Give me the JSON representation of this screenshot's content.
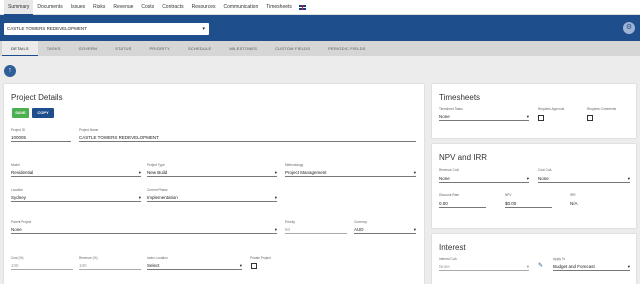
{
  "nav": {
    "items": [
      "Summary",
      "Documents",
      "Issues",
      "Risks",
      "Revenue",
      "Costs",
      "Contracts",
      "Resources",
      "Communication",
      "Timesheets"
    ]
  },
  "project": {
    "selected": "CASTLE TOWERS REDEVELOPMENT"
  },
  "tabs": [
    "DETAILS",
    "TASKS",
    "GOVERN",
    "STATUS",
    "PRIORITY",
    "SCHEDULE",
    "MILESTONES",
    "CUSTOM FIELDS",
    "PERIODIC FIELDS"
  ],
  "details": {
    "title": "Project Details",
    "save": "SAVE",
    "copy": "COPY",
    "id_label": "Project ID",
    "id": "100005",
    "name_label": "Project Name",
    "name": "CASTLE TOWERS REDEVELOPMENT",
    "model_label": "Model",
    "model": "Residential",
    "type_label": "Project Type",
    "type": "New Build",
    "method_label": "Methodology",
    "method": "Project Management",
    "location_label": "Location",
    "location": "Sydney",
    "phase_label": "Current Phase",
    "phase": "Implementation",
    "parent_label": "Parent Project",
    "parent": "None",
    "priority_label": "Priority",
    "priority": "50",
    "currency_label": "Currency",
    "currency": "AUD",
    "cost_label": "Cost (%)",
    "cost": "100",
    "revenue_label": "Revenue (%)",
    "revenue": "100",
    "index_label": "Index Location",
    "index": "Select",
    "private_label": "Private Project"
  },
  "timesheets": {
    "title": "Timesheets",
    "ts_label": "Timesheet Tasks",
    "ts": "None",
    "approval_label": "Requires Approval",
    "comments_label": "Requires Comments"
  },
  "npv": {
    "title": "NPV and IRR",
    "rev_label": "Revenue CoA",
    "rev": "None",
    "cost_label": "Cost CoA",
    "cost": "None",
    "rate_label": "Discount Rate",
    "rate": "0.00",
    "npv_label": "NPV",
    "npv": "$0.00",
    "irr_label": "IRR",
    "irr": "N/A"
  },
  "interest": {
    "title": "Interest",
    "coa_label": "Interest CoA",
    "coa": "None",
    "apply_label": "Apply To",
    "apply": "Budget and Forecast"
  }
}
